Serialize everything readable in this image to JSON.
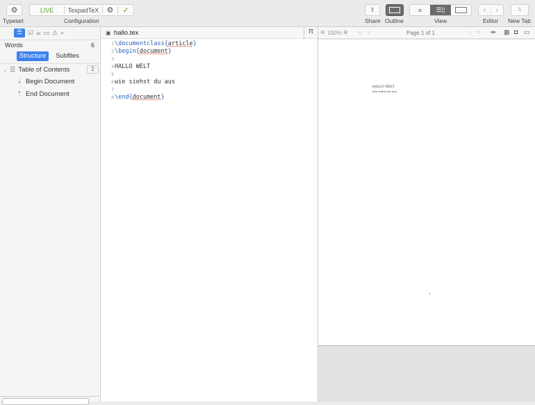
{
  "toolbar": {
    "typeset_label": "Typeset",
    "live": "LIVE",
    "engine": "TexpadTeX",
    "configuration_label": "Configuration",
    "share_label": "Share",
    "outline_label": "Outline",
    "view_label": "View",
    "editor_label": "Editor",
    "new_tab_label": "New Tab"
  },
  "sidebar": {
    "words_label": "Words",
    "words_count": "6",
    "tabs": [
      "Structure",
      "Subfiles"
    ],
    "toc_label": "Table of Contents",
    "toc_count": "2",
    "items": [
      "Begin Document",
      "End Document"
    ]
  },
  "editor": {
    "filename": "hallo.tex",
    "lines": [
      {
        "n": "1"
      },
      {
        "n": "2"
      },
      {
        "n": "3"
      },
      {
        "n": "4",
        "t": "HALLO WELT"
      },
      {
        "n": "5"
      },
      {
        "n": "6",
        "t": "wie siehst du aus"
      },
      {
        "n": "7"
      },
      {
        "n": "8"
      }
    ],
    "l1_cmd": "\\documentclass",
    "l1_arg": "article",
    "l2_cmd": "\\begin",
    "l2_arg": "document",
    "l8_cmd": "\\end",
    "l8_arg": "document",
    "pi": "π"
  },
  "pdf": {
    "zoom": "100%",
    "page_indicator": "Page 1 of 1",
    "page_title": "HALLO WELT",
    "page_text": "wie siehst du aus",
    "page_number": "1"
  },
  "colors": {
    "accent": "#3b82f0",
    "live": "#5aa02c"
  }
}
